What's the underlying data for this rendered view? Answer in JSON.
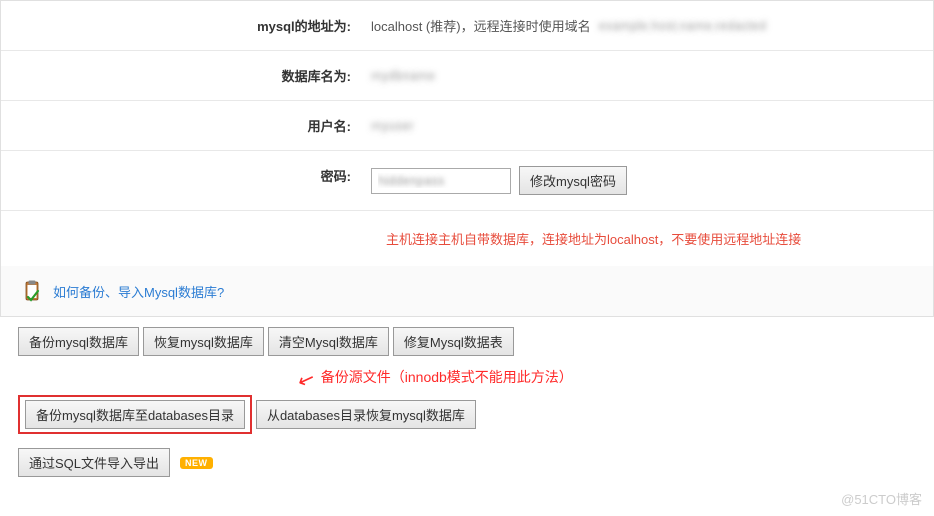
{
  "form": {
    "rows": [
      {
        "label": "mysql的地址为:",
        "value": "localhost (推荐)，远程连接时使用域名",
        "extra_blur": "example.host.name.redacted"
      },
      {
        "label": "数据库名为:",
        "value": "mydbname"
      },
      {
        "label": "用户名:",
        "value": "myuser"
      }
    ],
    "password_label": "密码:",
    "password_value": "hiddenpass",
    "change_pwd_btn": "修改mysql密码"
  },
  "warning": "主机连接主机自带数据库，连接地址为localhost，不要使用远程地址连接",
  "help_link": "如何备份、导入Mysql数据库?",
  "actions": {
    "row1": [
      "备份mysql数据库",
      "恢复mysql数据库",
      "清空Mysql数据库",
      "修复Mysql数据表"
    ],
    "annotation": "备份源文件（innodb模式不能用此方法）",
    "row2_highlighted": "备份mysql数据库至databases目录",
    "row2_other": "从databases目录恢复mysql数据库",
    "row3": "通过SQL文件导入导出",
    "new_badge": "NEW"
  },
  "watermark": "@51CTO博客"
}
